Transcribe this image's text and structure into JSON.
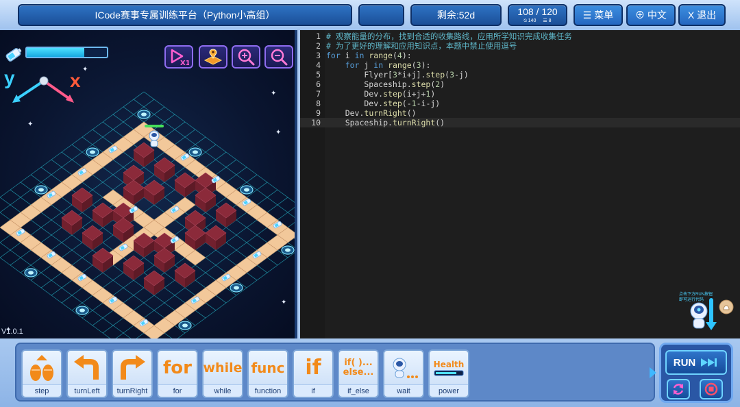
{
  "header": {
    "title": "ICode赛事专属训练平台（Python小高组）",
    "remaining": "剩余:52d",
    "score": "108 / 120",
    "score_sub_1": "⍉ 140",
    "score_sub_2": "☰ 8",
    "menu_label": "☰ 菜单",
    "lang_label": "⊕ 中文",
    "exit_label": "X 退出"
  },
  "game": {
    "energy_level": 0.72,
    "axis_y": "y",
    "axis_x": "x",
    "version": "V1.0.1",
    "colors": {
      "grid": "#2ad0e0",
      "tile": "#f2c89a",
      "block": "#8b2a3a",
      "accent": "#8e6cf0"
    }
  },
  "editor": {
    "lines": [
      {
        "n": "1",
        "text": "# 观察能量的分布，找到合适的收集路线，应用所学知识完成收集任务"
      },
      {
        "n": "2",
        "text": "# 为了更好的理解和应用知识点，本题中禁止使用逗号"
      },
      {
        "n": "3",
        "text": "for i in range(4):"
      },
      {
        "n": "4",
        "text": "    for j in range(3):"
      },
      {
        "n": "5",
        "text": "        Flyer[3*i+j].step(3-j)"
      },
      {
        "n": "6",
        "text": "        Spaceship.step(2)"
      },
      {
        "n": "7",
        "text": "        Dev.step(i+j+1)"
      },
      {
        "n": "8",
        "text": "        Dev.step(-1-i-j)"
      },
      {
        "n": "9",
        "text": "    Dev.turnRight()"
      },
      {
        "n": "10",
        "text": "    Spaceship.turnRight()"
      }
    ],
    "hint": [
      "点击下方RUN按钮",
      "即可运行代码"
    ]
  },
  "palette": {
    "blocks": [
      {
        "label": "step",
        "icon": "step-icon"
      },
      {
        "label": "turnLeft",
        "icon": "turn-left-icon"
      },
      {
        "label": "turnRight",
        "icon": "turn-right-icon"
      },
      {
        "label": "for",
        "icon": "for-icon",
        "word": "for"
      },
      {
        "label": "while",
        "icon": "while-icon",
        "word": "while"
      },
      {
        "label": "function",
        "icon": "function-icon",
        "word": "func"
      },
      {
        "label": "if",
        "icon": "if-icon",
        "word": "if"
      },
      {
        "label": "if_else",
        "icon": "if-else-icon",
        "word1": "if( )...",
        "word2": "else..."
      },
      {
        "label": "wait",
        "icon": "wait-icon"
      },
      {
        "label": "power",
        "icon": "power-icon",
        "word": "Health"
      }
    ],
    "run_label": "RUN"
  }
}
